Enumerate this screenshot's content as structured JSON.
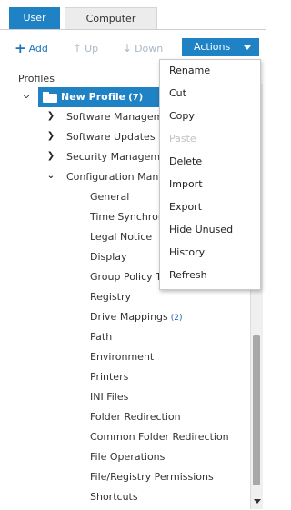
{
  "tabs": {
    "user": "User",
    "computer": "Computer"
  },
  "toolbar": {
    "add": "Add",
    "up": "Up",
    "down": "Down",
    "actions": "Actions"
  },
  "tree": {
    "label": "Profiles",
    "root": {
      "label": "New Profile",
      "count": "(7)"
    },
    "groups": [
      {
        "label": "Software Management"
      },
      {
        "label": "Software Updates"
      },
      {
        "label": "Security Management"
      },
      {
        "label": "Configuration Management"
      }
    ],
    "items": [
      {
        "label": "General"
      },
      {
        "label": "Time Synchronization"
      },
      {
        "label": "Legal Notice"
      },
      {
        "label": "Display"
      },
      {
        "label": "Group Policy Templates"
      },
      {
        "label": "Registry"
      },
      {
        "label": "Drive Mappings",
        "count": "(2)"
      },
      {
        "label": "Path"
      },
      {
        "label": "Environment"
      },
      {
        "label": "Printers"
      },
      {
        "label": "INI Files"
      },
      {
        "label": "Folder Redirection"
      },
      {
        "label": "Common Folder Redirection"
      },
      {
        "label": "File Operations"
      },
      {
        "label": "File/Registry Permissions"
      },
      {
        "label": "Shortcuts"
      }
    ]
  },
  "menu": {
    "items": [
      {
        "label": "Rename",
        "enabled": true
      },
      {
        "label": "Cut",
        "enabled": true
      },
      {
        "label": "Copy",
        "enabled": true
      },
      {
        "label": "Paste",
        "enabled": false
      },
      {
        "label": "Delete",
        "enabled": true
      },
      {
        "label": "Import",
        "enabled": true
      },
      {
        "label": "Export",
        "enabled": true
      },
      {
        "label": "Hide Unused",
        "enabled": true
      },
      {
        "label": "History",
        "enabled": true
      },
      {
        "label": "Refresh",
        "enabled": true
      }
    ]
  },
  "colors": {
    "accent": "#1e82c5",
    "disabled": "#c2c2c2",
    "link": "#1e73b8"
  }
}
